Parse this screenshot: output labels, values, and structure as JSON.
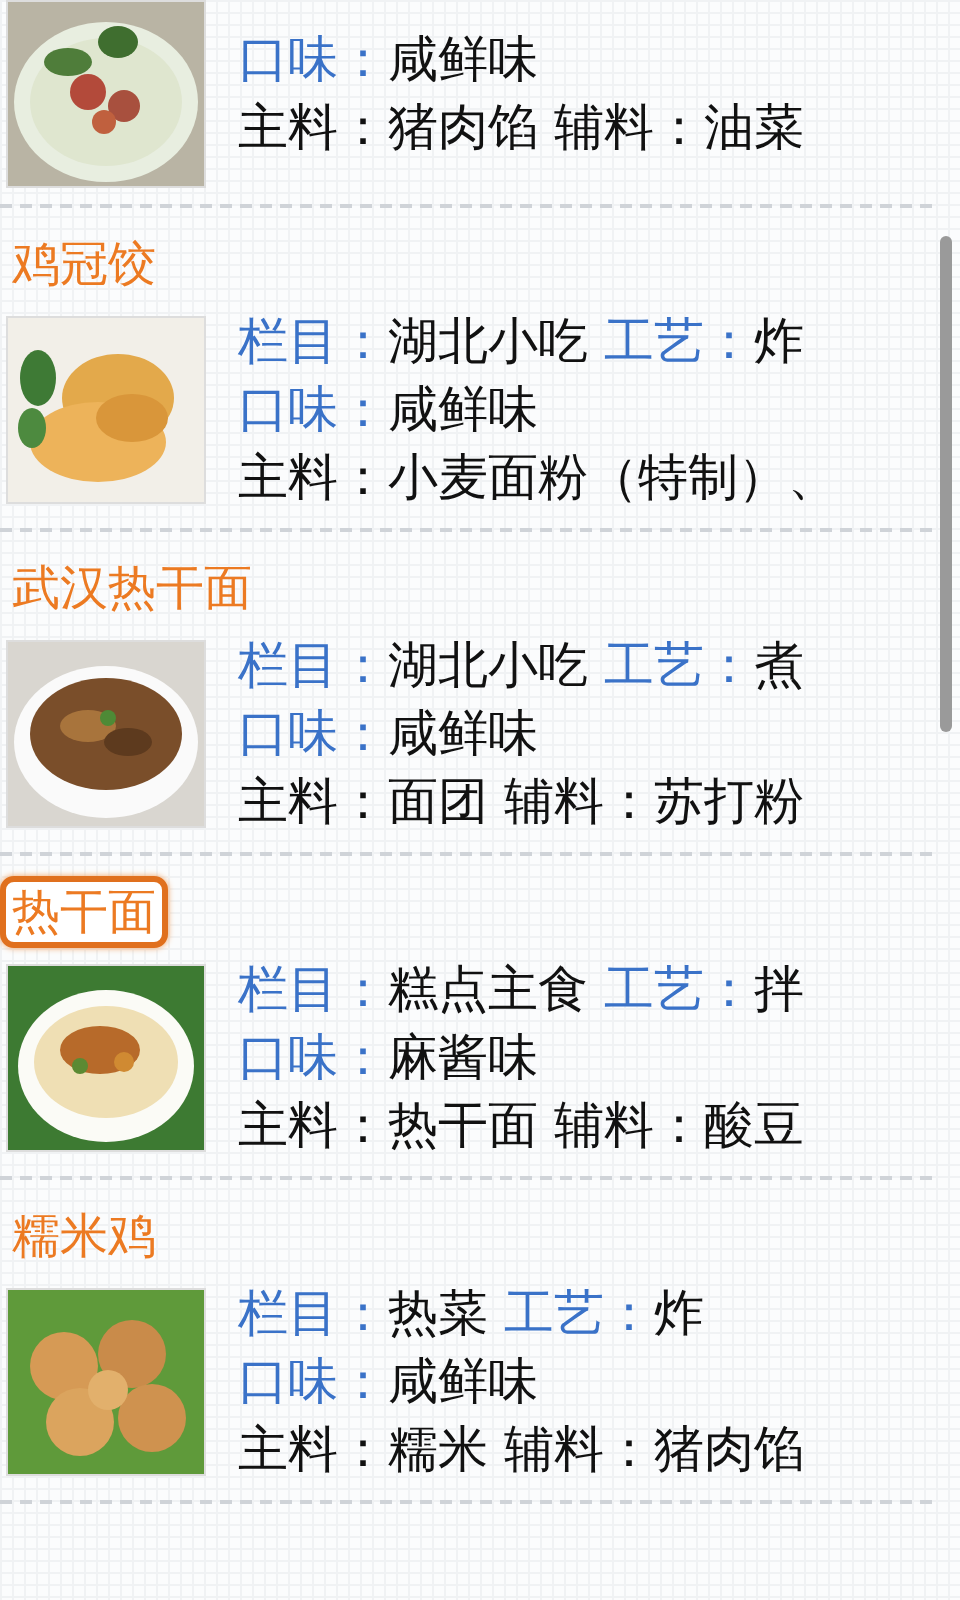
{
  "dishes": [
    {
      "photo": {
        "kind": "picture"
      },
      "lines": [
        [
          {
            "kind": "label",
            "text": "口味："
          },
          {
            "kind": "value",
            "text": "咸鲜味"
          }
        ],
        [
          {
            "kind": "value",
            "text": "主料：猪肉馅 辅料：油菜"
          }
        ]
      ]
    },
    {
      "title": "鸡冠饺",
      "photo": {
        "kind": "picture"
      },
      "selected": false,
      "lines": [
        [
          {
            "kind": "label",
            "text": "栏目："
          },
          {
            "kind": "value",
            "text": "湖北小吃 "
          },
          {
            "kind": "label",
            "text": "工艺："
          },
          {
            "kind": "value",
            "text": "炸"
          }
        ],
        [
          {
            "kind": "label",
            "text": "口味："
          },
          {
            "kind": "value",
            "text": "咸鲜味"
          }
        ],
        [
          {
            "kind": "value",
            "text": "主料：小麦面粉（特制）、"
          }
        ]
      ]
    },
    {
      "title": "武汉热干面",
      "photo": {
        "kind": "picture"
      },
      "selected": false,
      "lines": [
        [
          {
            "kind": "label",
            "text": "栏目："
          },
          {
            "kind": "value",
            "text": "湖北小吃 "
          },
          {
            "kind": "label",
            "text": "工艺："
          },
          {
            "kind": "value",
            "text": "煮"
          }
        ],
        [
          {
            "kind": "label",
            "text": "口味："
          },
          {
            "kind": "value",
            "text": "咸鲜味"
          }
        ],
        [
          {
            "kind": "value",
            "text": "主料：面团 辅料：苏打粉"
          }
        ]
      ]
    },
    {
      "title": "热干面",
      "photo": {
        "kind": "picture"
      },
      "selected": true,
      "lines": [
        [
          {
            "kind": "label",
            "text": "栏目："
          },
          {
            "kind": "value",
            "text": "糕点主食 "
          },
          {
            "kind": "label",
            "text": "工艺："
          },
          {
            "kind": "value",
            "text": "拌"
          }
        ],
        [
          {
            "kind": "label",
            "text": "口味："
          },
          {
            "kind": "value",
            "text": "麻酱味"
          }
        ],
        [
          {
            "kind": "value",
            "text": "主料：热干面 辅料：酸豆"
          }
        ]
      ]
    },
    {
      "title": "糯米鸡",
      "photo": {
        "kind": "picture"
      },
      "selected": false,
      "lines": [
        [
          {
            "kind": "label",
            "text": "栏目："
          },
          {
            "kind": "value",
            "text": "热菜 "
          },
          {
            "kind": "label",
            "text": "工艺："
          },
          {
            "kind": "value",
            "text": "炸"
          }
        ],
        [
          {
            "kind": "label",
            "text": "口味："
          },
          {
            "kind": "value",
            "text": "咸鲜味"
          }
        ],
        [
          {
            "kind": "value",
            "text": "主料：糯米 辅料：猪肉馅"
          }
        ]
      ]
    }
  ]
}
